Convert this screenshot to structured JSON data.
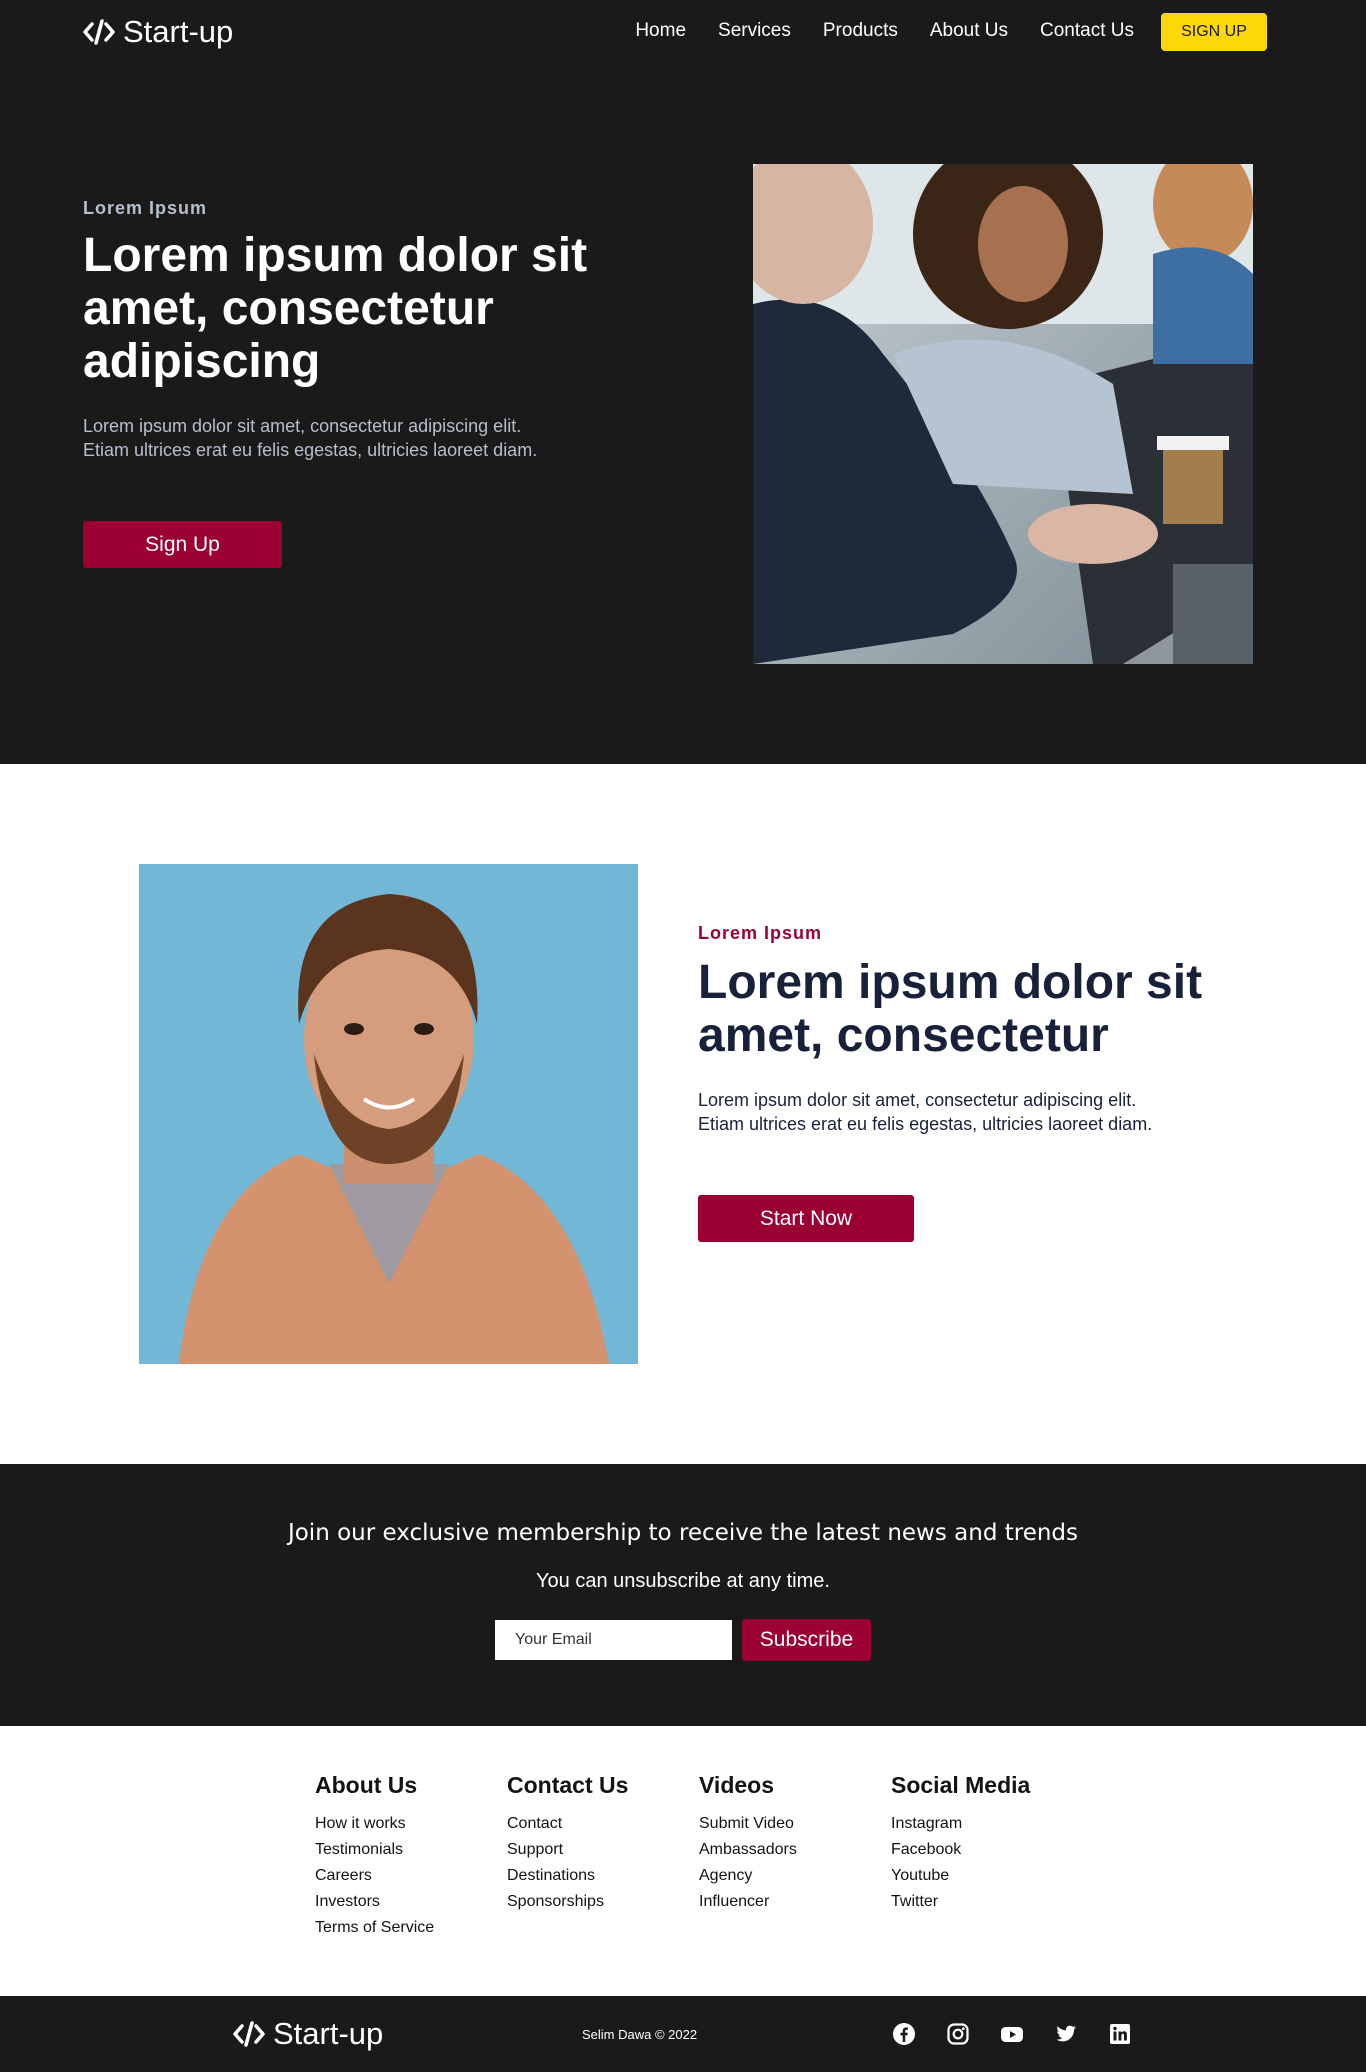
{
  "nav": {
    "brand": "Start-up",
    "links": [
      "Home",
      "Services",
      "Products",
      "About Us",
      "Contact Us"
    ],
    "signup": "SIGN UP"
  },
  "hero": {
    "eyebrow": "Lorem Ipsum",
    "title": "Lorem ipsum dolor sit amet, consectetur adipiscing",
    "text": "Lorem ipsum dolor sit amet, consectetur adipiscing elit. Etiam ultrices erat eu felis egestas, ultricies laoreet diam.",
    "button": "Sign Up"
  },
  "feature": {
    "eyebrow": "Lorem Ipsum",
    "title": "Lorem ipsum dolor sit amet, consectetur",
    "text": "Lorem ipsum dolor sit amet, consectetur adipiscing elit. Etiam ultrices erat eu felis egestas, ultricies laoreet diam.",
    "button": "Start Now"
  },
  "newsletter": {
    "heading": "Join our exclusive membership to receive the latest news and trends",
    "sub": "You can unsubscribe at any time.",
    "placeholder": "Your Email",
    "button": "Subscribe"
  },
  "footer": {
    "columns": [
      {
        "title": "About Us",
        "links": [
          "How it works",
          "Testimonials",
          "Careers",
          "Investors",
          "Terms of Service"
        ]
      },
      {
        "title": "Contact Us",
        "links": [
          "Contact",
          "Support",
          "Destinations",
          "Sponsorships"
        ]
      },
      {
        "title": "Videos",
        "links": [
          "Submit Video",
          "Ambassadors",
          "Agency",
          "Influencer"
        ]
      },
      {
        "title": "Social Media",
        "links": [
          "Instagram",
          "Facebook",
          "Youtube",
          "Twitter"
        ]
      }
    ],
    "brand": "Start-up",
    "copyright": "Selim Dawa © 2022",
    "social_icons": [
      "facebook-icon",
      "instagram-icon",
      "youtube-icon",
      "twitter-icon",
      "linkedin-icon"
    ]
  },
  "colors": {
    "dark": "#1a1a1b",
    "accent": "#9a0036",
    "yellow": "#fcd80a",
    "navy": "#18213a"
  }
}
